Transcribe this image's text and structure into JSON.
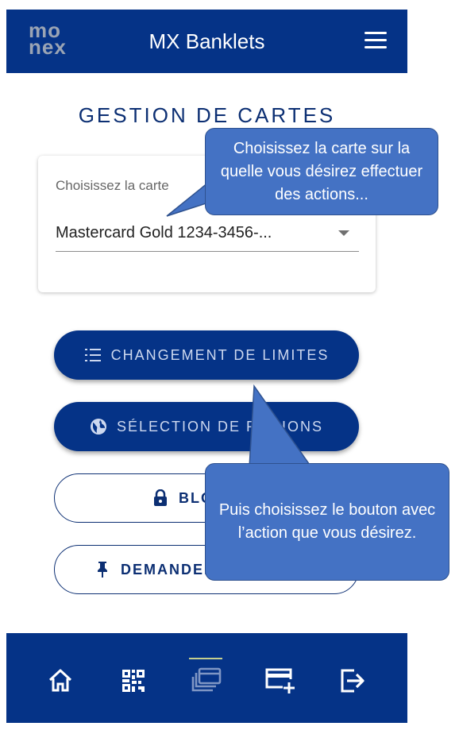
{
  "header": {
    "logo_top": "mo",
    "logo_bottom": "nex",
    "title": "MX Banklets",
    "menu_icon": "hamburger-menu-icon"
  },
  "main": {
    "title": "GESTION DE CARTES",
    "card_select": {
      "label": "Choisissez la carte",
      "value": "Mastercard Gold 1234-3456-..."
    },
    "actions": [
      {
        "label": "CHANGEMENT DE LIMITES",
        "icon": "list-icon",
        "style": "filled"
      },
      {
        "label": "SÉLECTION DE RÉGIONS",
        "icon": "globe-icon",
        "style": "filled"
      },
      {
        "label": "BLOQUER",
        "icon": "lock-icon",
        "style": "outline"
      },
      {
        "label": "DEMANDER UNE CARTE",
        "icon": "pin-icon",
        "style": "outline"
      }
    ]
  },
  "bottom_nav": {
    "items": [
      {
        "icon": "home-icon",
        "active": false
      },
      {
        "icon": "qr-code-icon",
        "active": false
      },
      {
        "icon": "cards-stack-icon",
        "active": true
      },
      {
        "icon": "add-card-icon",
        "active": false
      },
      {
        "icon": "logout-icon",
        "active": false
      }
    ]
  },
  "callouts": {
    "top": "Choisissez la carte sur la quelle vous désirez effectuer des actions...",
    "bottom": "Puis choisissez le bouton avec l’action que vous désirez."
  },
  "colors": {
    "primary": "#053387",
    "callout": "#4472c4",
    "accent_indicator": "#c6cf8e"
  }
}
